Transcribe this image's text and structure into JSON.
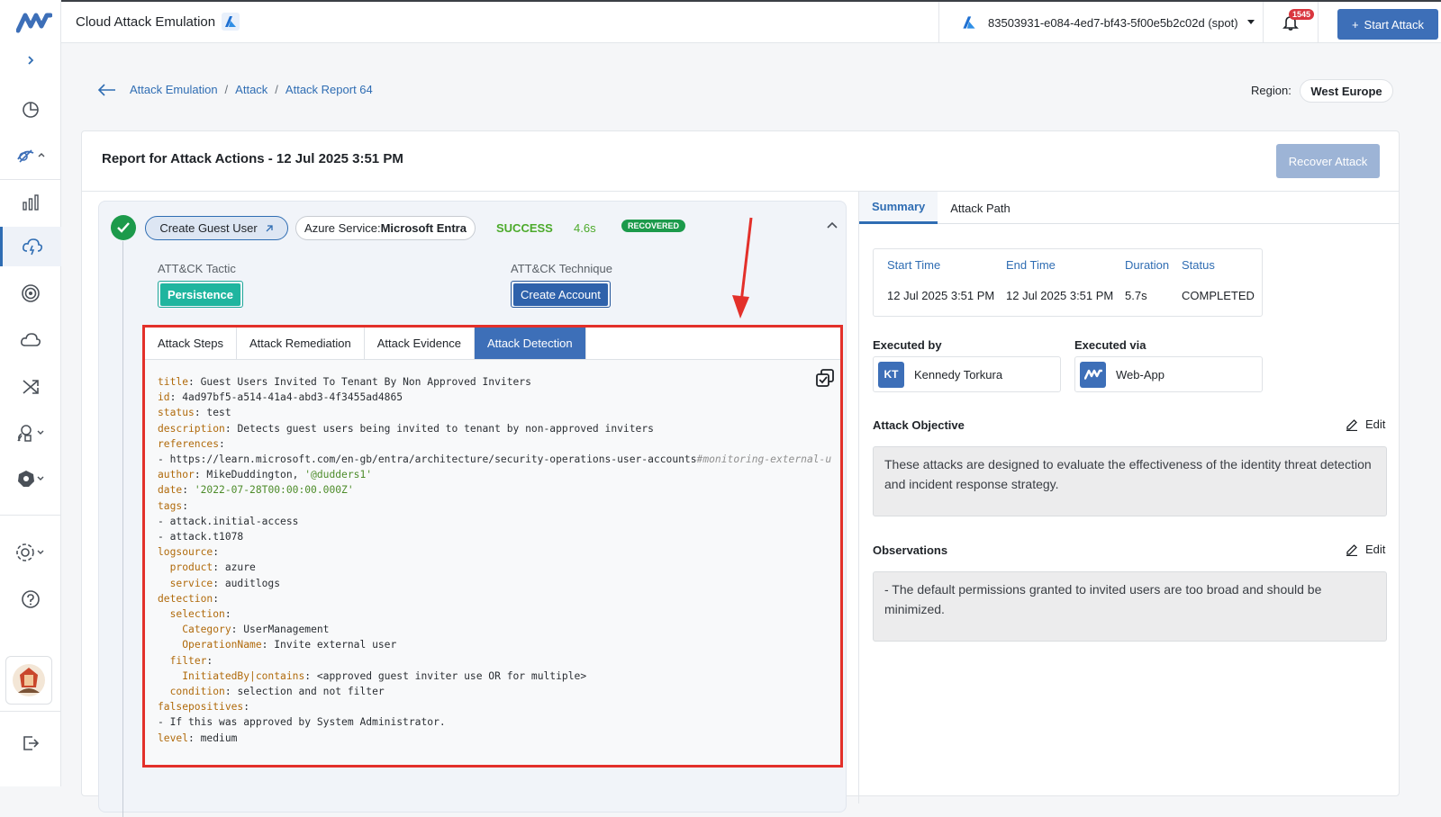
{
  "app": {
    "title": "Cloud Attack Emulation",
    "subscription": "83503931-e084-4ed7-bf43-5f00e5b2c02d (spot)",
    "notification_count": "1545",
    "start_attack_label": "Start Attack"
  },
  "breadcrumb": {
    "items": [
      "Attack Emulation",
      "Attack",
      "Attack Report 64"
    ]
  },
  "region": {
    "label": "Region:",
    "value": "West Europe"
  },
  "report": {
    "title": "Report for Attack Actions - 12 Jul 2025 3:51 PM",
    "recover_label": "Recover Attack"
  },
  "action": {
    "name": "Create Guest User",
    "service_label": "Azure Service:",
    "service_value": "Microsoft Entra",
    "status": "SUCCESS",
    "duration": "4.6s",
    "recovered_label": "RECOVERED",
    "tactic_label": "ATT&CK Tactic",
    "tactic_value": "Persistence",
    "technique_label": "ATT&CK Technique",
    "technique_value": "Create Account"
  },
  "detection_tabs": [
    "Attack Steps",
    "Attack Remediation",
    "Attack Evidence",
    "Attack Detection"
  ],
  "detection_active_tab": "Attack Detection",
  "detection_rule": {
    "title": "Guest Users Invited To Tenant By Non Approved Inviters",
    "id": "4ad97bf5-a514-41a4-abd3-4f3455ad4865",
    "status": "test",
    "description": "Detects guest users being invited to tenant by non-approved inviters",
    "reference_url": "https://learn.microsoft.com/en-gb/entra/architecture/security-operations-user-accounts",
    "reference_anchor": "#monitoring-external-u",
    "author": "MikeDuddington, ",
    "author_handle": "'@dudders1'",
    "date": "'2022-07-28T00:00:00.000Z'",
    "tags": [
      "attack.initial-access",
      "attack.t1078"
    ],
    "logsource_product": "azure",
    "logsource_service": "auditlogs",
    "selection_category": "UserManagement",
    "selection_operation": "Invite external user",
    "filter_initiated_by": "<approved guest inviter use OR for multiple>",
    "condition": "selection and not filter",
    "falsepositive": "If this was approved by System Administrator.",
    "level": "medium"
  },
  "summary": {
    "tabs": [
      "Summary",
      "Attack Path"
    ],
    "start_time_label": "Start Time",
    "end_time_label": "End Time",
    "duration_label": "Duration",
    "status_label": "Status",
    "start_time": "12 Jul 2025 3:51 PM",
    "end_time": "12 Jul 2025 3:51 PM",
    "duration": "5.7s",
    "status": "COMPLETED",
    "executed_by_label": "Executed by",
    "executed_by_initials": "KT",
    "executed_by_name": "Kennedy Torkura",
    "executed_via_label": "Executed via",
    "executed_via_name": "Web-App",
    "objective_label": "Attack Objective",
    "objective_text": "These attacks are designed to evaluate the effectiveness of the identity threat detection and incident response strategy.",
    "observations_label": "Observations",
    "observations_text": "- The default permissions granted to invited users are too broad and should be minimized.",
    "edit_label": "Edit"
  },
  "colors": {
    "primary": "#3d6fb8",
    "success": "#1c9a4b",
    "highlight": "#e3302a",
    "teal": "#1fb59f"
  }
}
